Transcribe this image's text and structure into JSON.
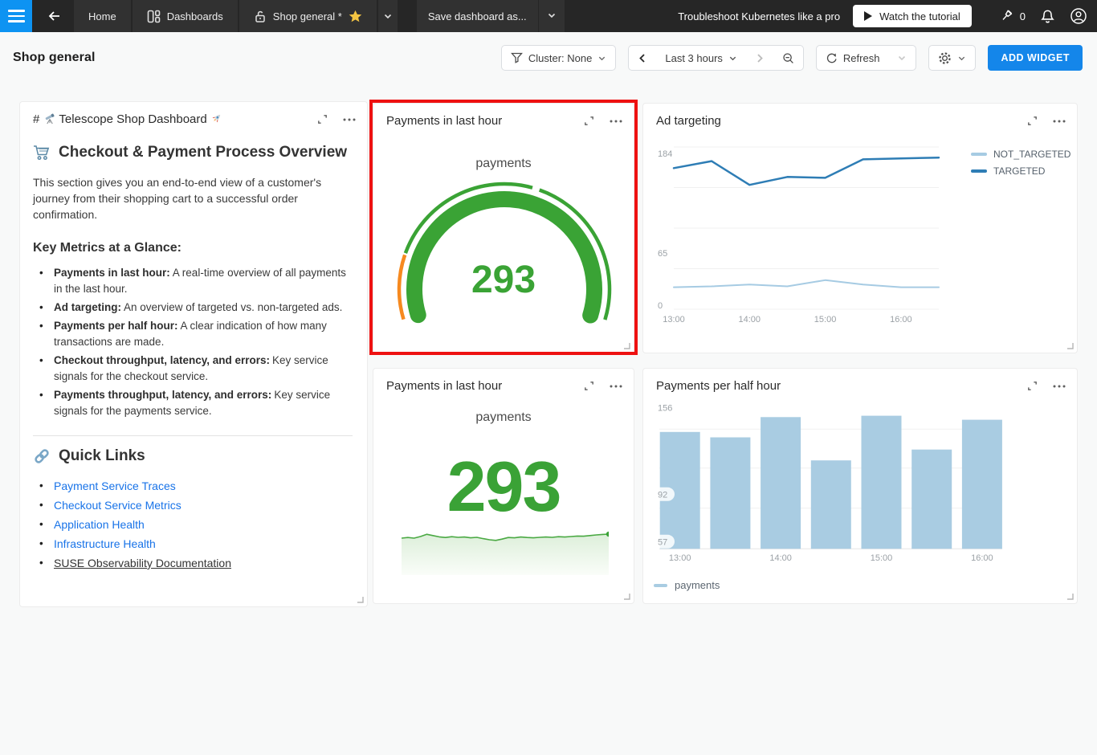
{
  "navbar": {
    "tabs": [
      {
        "label": "Home"
      },
      {
        "label": "Dashboards"
      },
      {
        "label": "Shop general *"
      }
    ],
    "save_button": "Save dashboard as...",
    "promo_text": "Troubleshoot Kubernetes like a pro",
    "watch_button": "Watch the tutorial",
    "pin_count": "0"
  },
  "header": {
    "title": "Shop general",
    "cluster_filter": "Cluster: None",
    "time_range": "Last 3 hours",
    "refresh_label": "Refresh",
    "add_widget": "ADD WIDGET"
  },
  "markdown": {
    "full_title": "# 🔭 Telescope Shop Dashboard 🚀",
    "title_prefix": "#",
    "title_emoji_left": "🔭",
    "title_text": "Telescope Shop Dashboard",
    "title_emoji_right": "🚀",
    "heading_emoji": "🛒",
    "heading": "Checkout & Payment Process Overview",
    "description": "This section gives you an end-to-end view of a customer's journey from their shopping cart to a successful order confirmation.",
    "metrics_heading": "Key Metrics at a Glance:",
    "metrics": [
      {
        "label": "Payments in last hour:",
        "text": "A real-time overview of all payments in the last hour."
      },
      {
        "label": "Ad targeting:",
        "text": "An overview of targeted vs. non-targeted ads."
      },
      {
        "label": "Payments per half hour:",
        "text": "A clear indication of how many transactions are made."
      },
      {
        "label": "Checkout throughput, latency, and errors:",
        "text": "Key service signals for the checkout service."
      },
      {
        "label": "Payments throughput, latency, and errors:",
        "text": "Key service signals for the payments service."
      }
    ],
    "links_heading_emoji": "🔗",
    "links_heading": "Quick Links",
    "links": [
      "Payment Service Traces",
      "Checkout Service Metrics",
      "Application Health",
      "Infrastructure Health"
    ],
    "doc_link": "SUSE Observability Documentation"
  },
  "widgets": {
    "gauge": {
      "title": "Payments in last hour",
      "label": "payments",
      "value": "293"
    },
    "ad_targeting": {
      "title": "Ad targeting"
    },
    "number": {
      "title": "Payments in last hour",
      "label": "payments",
      "value": "293"
    },
    "bars": {
      "title": "Payments per half hour",
      "legend": "payments"
    }
  },
  "chart_data": [
    {
      "id": "payments-gauge",
      "type": "gauge",
      "title": "Payments in last hour",
      "series_label": "payments",
      "value": 293,
      "colors": {
        "ok": "#3aa335",
        "warning": "#f6891f"
      }
    },
    {
      "id": "ad-targeting",
      "type": "line",
      "title": "Ad targeting",
      "x": [
        "13:00",
        "13:30",
        "14:00",
        "14:30",
        "15:00",
        "15:30",
        "16:00",
        "16:30"
      ],
      "x_ticks": [
        "13:00",
        "14:00",
        "15:00",
        "16:00"
      ],
      "y_ticks": [
        "184",
        "65",
        "0"
      ],
      "ylim": [
        0,
        195
      ],
      "grid": true,
      "legend_position": "right",
      "series": [
        {
          "name": "NOT_TARGETED",
          "color": "#a6cbe3",
          "values": [
            25,
            26,
            28,
            26,
            33,
            28,
            25,
            25
          ]
        },
        {
          "name": "TARGETED",
          "color": "#2e7db5",
          "values": [
            160,
            168,
            141,
            150,
            149,
            170,
            171,
            172
          ]
        }
      ]
    },
    {
      "id": "payments-number",
      "type": "number-sparkline",
      "title": "Payments in last hour",
      "label": "payments",
      "value": 293,
      "spark_color": "#4aa943",
      "spark_normalized": [
        0.5,
        0.54,
        0.5,
        0.6,
        0.74,
        0.66,
        0.58,
        0.54,
        0.59,
        0.55,
        0.57,
        0.52,
        0.55,
        0.47,
        0.4,
        0.36,
        0.44,
        0.54,
        0.52,
        0.57,
        0.54,
        0.52,
        0.55,
        0.57,
        0.55,
        0.59,
        0.57,
        0.6,
        0.63,
        0.62,
        0.66,
        0.7,
        0.73,
        0.75
      ]
    },
    {
      "id": "payments-per-half-hour",
      "type": "bar",
      "title": "Payments per half hour",
      "categories": [
        "13:00",
        "13:30",
        "14:00",
        "14:30",
        "15:00",
        "15:30",
        "16:00"
      ],
      "values": [
        138,
        134,
        149,
        117,
        150,
        125,
        147
      ],
      "x_ticks": [
        "13:00",
        "14:00",
        "15:00",
        "16:00"
      ],
      "y_ticks": [
        "156",
        "92",
        "57"
      ],
      "ylim": [
        52,
        163
      ],
      "legend": [
        "payments"
      ],
      "color": "#a9cce2"
    }
  ]
}
